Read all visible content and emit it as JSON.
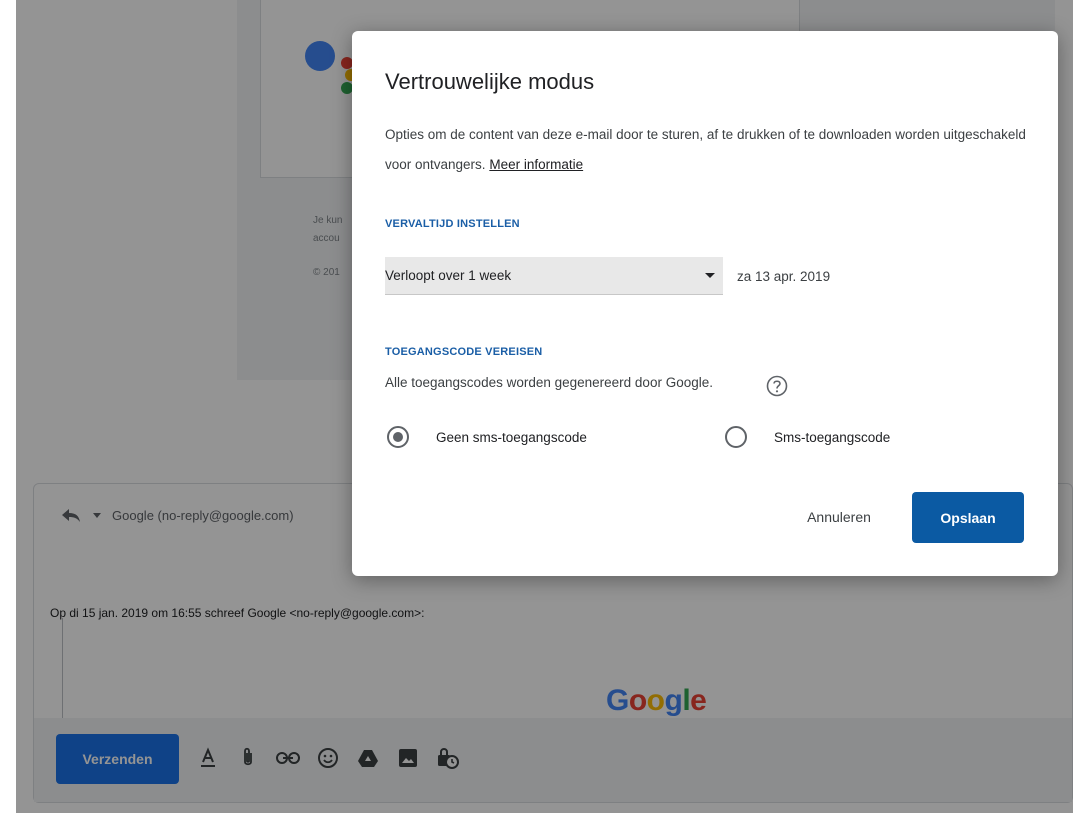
{
  "background": {
    "legal_lines": [
      "Je kun",
      "accou",
      "© 201"
    ],
    "reply_from": "Google (no-reply@google.com)",
    "quote_line": "Op di 15 jan. 2019 om 16:55 schreef Google <no-reply@google.com>:",
    "google_logo_letters": [
      "G",
      "o",
      "o",
      "g",
      "l",
      "e"
    ],
    "google_logo_colors": [
      "#4285F4",
      "#EA4335",
      "#FBBC05",
      "#4285F4",
      "#34A853",
      "#EA4335"
    ],
    "send_label": "Verzenden",
    "toolbar_icons": [
      "text-format-icon",
      "attach-icon",
      "link-icon",
      "emoji-icon",
      "drive-icon",
      "photo-icon",
      "confidential-mode-icon"
    ]
  },
  "dialog": {
    "title": "Vertrouwelijke modus",
    "description": "Opties om de content van deze e-mail door te sturen, af te drukken of te downloaden worden uitgeschakeld voor ontvangers.",
    "more_info_link": "Meer informatie",
    "expiry_heading": "VERVALTIJD INSTELLEN",
    "expiry_selected": "Verloopt over 1 week",
    "expiry_date": "za 13 apr. 2019",
    "passcode_heading": "TOEGANGSCODE VEREISEN",
    "passcode_note": "Alle toegangscodes worden gegenereerd door Google.",
    "options": [
      {
        "label": "Geen sms-toegangscode",
        "checked": true
      },
      {
        "label": "Sms-toegangscode",
        "checked": false
      }
    ],
    "cancel_label": "Annuleren",
    "save_label": "Opslaan"
  },
  "colors": {
    "accent_blue": "#0b5aa3",
    "heading_blue": "#1a5ea6",
    "send_blue": "#1a73e8"
  }
}
